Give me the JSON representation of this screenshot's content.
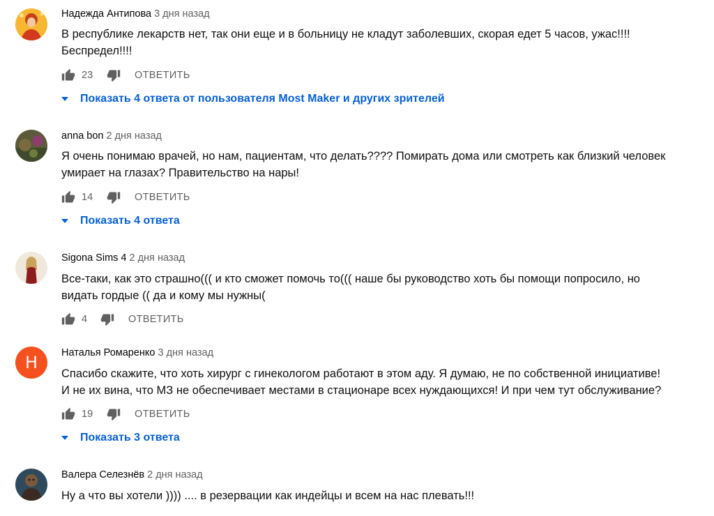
{
  "comments": [
    {
      "author": "Надежда Антипова",
      "time": "3 дня назад",
      "lines": [
        "В республике лекарств нет, так они еще и в больницу не кладут заболевших, скорая едет 5 часов, ужас!!!!",
        "Беспредел!!!!"
      ],
      "likes": "23",
      "reply_label": "ОТВЕТИТЬ",
      "show_replies": "Показать 4 ответа от пользователя Most Maker и других зрителей"
    },
    {
      "author": "anna bon",
      "time": "2 дня назад",
      "lines": [
        "Я очень понимаю врачей, но нам, пациентам, что делать???? Помирать дома или смотреть как близкий человек",
        "умирает на глазах? Правительство на нары!"
      ],
      "likes": "14",
      "reply_label": "ОТВЕТИТЬ",
      "show_replies": "Показать 4 ответа"
    },
    {
      "author": "Sigona Sims 4",
      "time": "2 дня назад",
      "lines": [
        "Все-таки, как это страшно((( и кто сможет помочь то((( наше бы руководство хоть бы помощи попросило, но",
        "видать гордые (( да и кому мы нужны("
      ],
      "likes": "4",
      "reply_label": "ОТВЕТИТЬ"
    },
    {
      "author": "Наталья Ромаренко",
      "time": "3 дня назад",
      "avatar_letter": "Н",
      "avatar_color": "#f4511e",
      "lines": [
        "Спасибо скажите, что хоть хирург с гинекологом работают в этом аду. Я думаю, не по собственной инициативе!",
        "И не их вина, что МЗ не обеспечивает местами в стационаре всех нуждающихся! И при чем тут обслуживание?"
      ],
      "likes": "19",
      "reply_label": "ОТВЕТИТЬ",
      "show_replies": "Показать 3 ответа"
    },
    {
      "author": "Валера Селезнёв",
      "time": "2 дня назад",
      "lines": [
        "Ну а что вы хотели )))) .... в резервации как индейцы и всем на нас плевать!!!"
      ]
    }
  ],
  "colors": {
    "link": "#065fd4",
    "meta": "#606060"
  },
  "icons": {
    "like": "thumb-up-icon",
    "dislike": "thumb-down-icon",
    "expand": "chevron-down-icon"
  }
}
